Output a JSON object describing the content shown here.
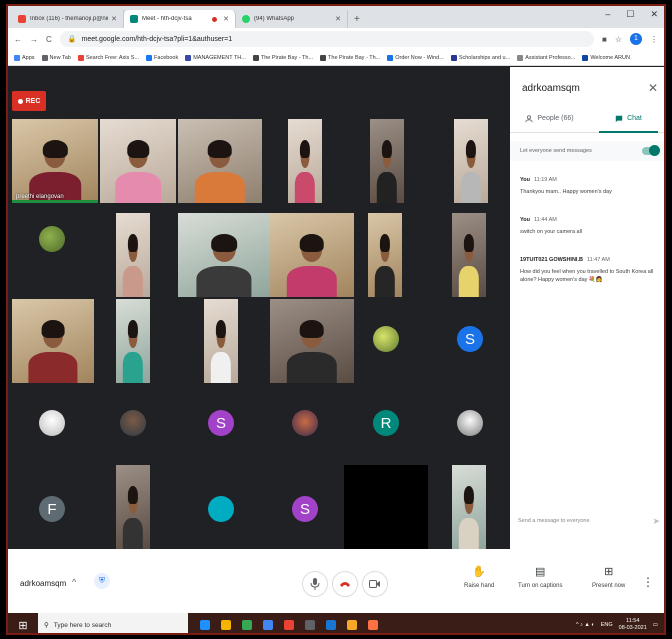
{
  "browser": {
    "tabs": [
      {
        "label": "Inbox (116) - themanoji.p@nirc",
        "color": "#ea4335"
      },
      {
        "label": "Meet - hth-dcjv-tsa",
        "color": "#00897b",
        "active": true
      },
      {
        "label": "(94) WhatsApp",
        "color": "#25d366"
      }
    ],
    "new_tab": "+",
    "win_min": "–",
    "win_max": "☐",
    "win_close": "✕",
    "url": "meet.google.com/hth-dcjv-tsa?pli=1&authuser=1",
    "profile_initial": "1",
    "bookmarks": [
      {
        "label": "Apps",
        "color": "#4285f4"
      },
      {
        "label": "New Tab",
        "color": "#5f6368"
      },
      {
        "label": "Search Free: Axis S...",
        "color": "#ea4335"
      },
      {
        "label": "Facebook",
        "color": "#1877f2"
      },
      {
        "label": "MANAGEMENT TH...",
        "color": "#3949ab"
      },
      {
        "label": "The Pirate Bay - Th...",
        "color": "#444"
      },
      {
        "label": "The Pirate Bay - Th...",
        "color": "#444"
      },
      {
        "label": "Order Now - Wind...",
        "color": "#1a73e8"
      },
      {
        "label": "Scholarships and u...",
        "color": "#283593"
      },
      {
        "label": "Assistant Professo...",
        "color": "#888"
      },
      {
        "label": "Welcome ARUN",
        "color": "#0d47a1"
      }
    ]
  },
  "meet": {
    "rec_label": "REC",
    "tiles_row1": [
      {
        "name": "preethi elangovan",
        "kind": "video",
        "variant": "alt3",
        "shirt": "#7b1f2f",
        "active": true
      },
      {
        "name": "",
        "kind": "video",
        "variant": "alt1",
        "shirt": "#e58cae"
      },
      {
        "name": "",
        "kind": "video",
        "variant": "",
        "shirt": "#d9793a"
      },
      {
        "name": "",
        "kind": "video",
        "variant": "alt1",
        "shirt": "#c94a6b"
      },
      {
        "name": "",
        "kind": "video",
        "variant": "alt2",
        "shirt": "#222"
      },
      {
        "name": "",
        "kind": "video",
        "variant": "alt1",
        "shirt": "#b7b7b7"
      }
    ],
    "avatars": {
      "r2c1": "",
      "r3c5": "",
      "r3c6": "S",
      "r4c1": "",
      "r4c2": "",
      "r4c3": "S",
      "r4c4": "",
      "r4c5": "R",
      "r4c6": "",
      "r5c1": "F",
      "r5c3": "",
      "r5c4": "S"
    }
  },
  "panel": {
    "title": "adrkoamsqm",
    "close": "✕",
    "people_tab": "People (66)",
    "chat_tab": "Chat",
    "setting_label": "Let everyone send messages",
    "messages": [
      {
        "sender": "You",
        "time": "11:19 AM",
        "text": "Thankyou mam.. Happy women's day"
      },
      {
        "sender": "You",
        "time": "11:44 AM",
        "text": "switch on your camera all"
      },
      {
        "sender": "19TUIT021 GOWSHINI.B",
        "time": "11:47 AM",
        "text": "How did you feel when you travelled to South Korea all alone? Happy women's day 💐👩"
      }
    ],
    "send_placeholder": "Send a message to everyone",
    "send_icon": "➤"
  },
  "bottom": {
    "meeting_code": "adrkoamsqm",
    "caret": "^",
    "raise_hand": "Raise hand",
    "captions": "Turn on captions",
    "present": "Present now",
    "more": "⋮"
  },
  "taskbar": {
    "search_placeholder": "Type here to search",
    "lang": "ENG",
    "time": "11:54",
    "date": "08-03-2021",
    "icons": [
      "#1e90ff",
      "#f4b400",
      "#34a853",
      "#4285f4",
      "#ea4335",
      "#5f6368",
      "#1976d2",
      "#f9a825",
      "#ff7043"
    ]
  }
}
